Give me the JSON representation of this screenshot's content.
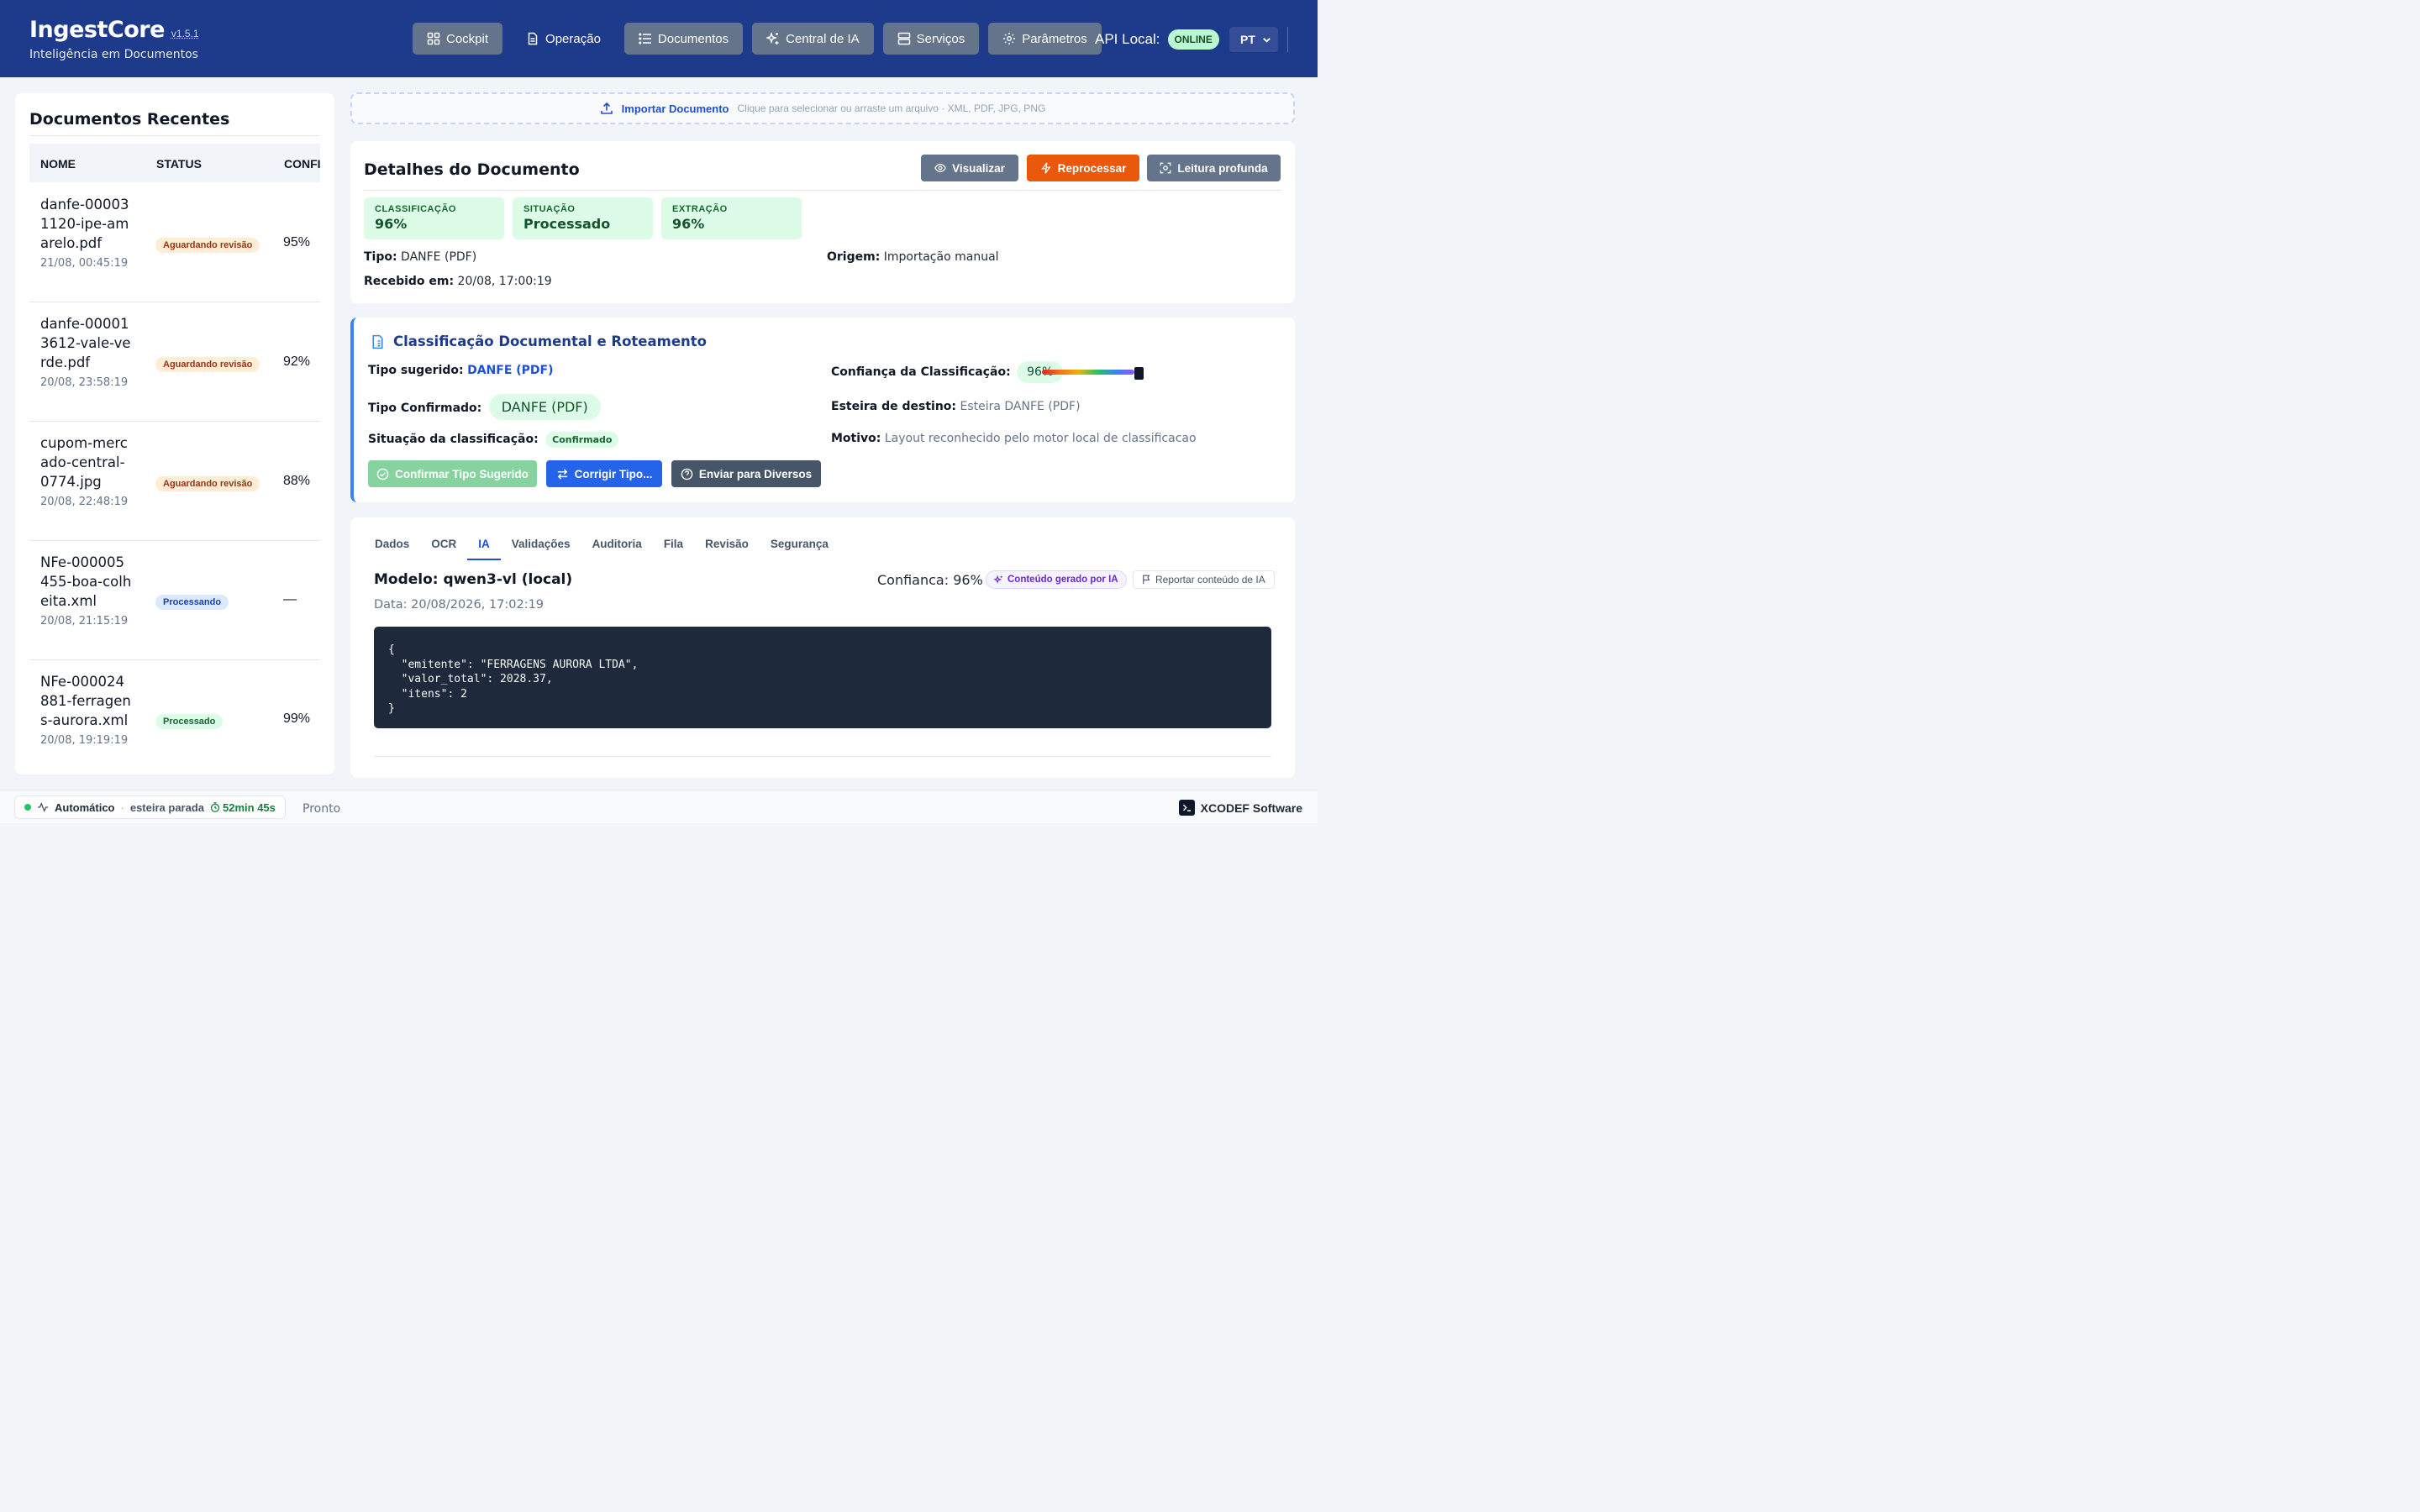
{
  "header": {
    "brand": "IngestCore",
    "version": "v1.5.1",
    "subtitle": "Inteligência em Documentos",
    "nav": [
      {
        "label": "Cockpit",
        "icon": "grid-icon"
      },
      {
        "label": "Operação",
        "icon": "file-icon"
      },
      {
        "label": "Documentos",
        "icon": "list-icon"
      },
      {
        "label": "Central de IA",
        "icon": "sparkles-icon"
      },
      {
        "label": "Serviços",
        "icon": "server-icon"
      },
      {
        "label": "Parâmetros",
        "icon": "gear-icon"
      }
    ],
    "api_label": "API Local:",
    "api_status": "ONLINE",
    "language": "PT"
  },
  "recent": {
    "title": "Documentos Recentes",
    "columns": [
      "NOME",
      "STATUS",
      "CONFI"
    ],
    "rows": [
      {
        "name": "danfe-000031120-ipe-amarelo.pdf",
        "date": "21/08, 00:45:19",
        "status": "Aguardando revisão",
        "conf": "95%"
      },
      {
        "name": "danfe-000013612-vale-verde.pdf",
        "date": "20/08, 23:58:19",
        "status": "Aguardando revisão",
        "conf": "92%"
      },
      {
        "name": "cupom-mercado-central-0774.jpg",
        "date": "20/08, 22:48:19",
        "status": "Aguardando revisão",
        "conf": "88%"
      },
      {
        "name": "NFe-000005455-boa-colheita.xml",
        "date": "20/08, 21:15:19",
        "status": "Processando",
        "conf": "—"
      },
      {
        "name": "NFe-000024881-ferragens-aurora.xml",
        "date": "20/08, 19:19:19",
        "status": "Processado",
        "conf": "99%"
      }
    ]
  },
  "upload": {
    "label": "Importar Documento",
    "hint": "Clique para selecionar ou arraste um arquivo · XML, PDF, JPG, PNG"
  },
  "details": {
    "title": "Detalhes do Documento",
    "actions": {
      "view": "Visualizar",
      "reprocess": "Reprocessar",
      "deep": "Leitura profunda"
    },
    "metrics": [
      {
        "label": "CLASSIFICAÇÃO",
        "value": "96%"
      },
      {
        "label": "SITUAÇÃO",
        "value": "Processado"
      },
      {
        "label": "EXTRAÇÃO",
        "value": "96%"
      }
    ],
    "tipo_label": "Tipo:",
    "tipo": "DANFE (PDF)",
    "origem_label": "Origem:",
    "origem": "Importação manual",
    "recebido_label": "Recebido em:",
    "recebido": "20/08, 17:00:19"
  },
  "classification": {
    "title": "Classificação Documental e Roteamento",
    "suggested_label": "Tipo sugerido:",
    "suggested": "DANFE (PDF)",
    "confirmed_label": "Tipo Confirmado:",
    "confirmed": "DANFE (PDF)",
    "situation_label": "Situação da classificação:",
    "situation": "Confirmado",
    "confidence_label": "Confiança da Classificação:",
    "confidence": "96%",
    "confidence_value": 0.96,
    "lane_label": "Esteira de destino:",
    "lane": "Esteira DANFE (PDF)",
    "reason_label": "Motivo:",
    "reason": "Layout reconhecido pelo motor local de classificacao",
    "buttons": {
      "confirm": "Confirmar Tipo Sugerido",
      "fix": "Corrigir Tipo...",
      "send": "Enviar para Diversos"
    }
  },
  "ia": {
    "tabs": [
      "Dados",
      "OCR",
      "IA",
      "Validações",
      "Auditoria",
      "Fila",
      "Revisão",
      "Segurança"
    ],
    "active_tab": "IA",
    "model": "Modelo: qwen3-vl (local)",
    "date": "Data: 20/08/2026, 17:02:19",
    "confidence": "Confianca: 96%",
    "generated_badge": "Conteúdo gerado por IA",
    "report": "Reportar conteúdo de IA",
    "code": "{\n  \"emitente\": \"FERRAGENS AURORA LTDA\",\n  \"valor_total\": 2028.37,\n  \"itens\": 2\n}"
  },
  "footer": {
    "mode": "Automático",
    "separator": "·",
    "lane_state": "esteira parada",
    "timer": "52min 45s",
    "state": "Pronto",
    "brand": "XCODEF Software"
  },
  "colors": {
    "header": "#1e3a8a",
    "accent": "#1d4ed8",
    "reprocess": "#ea580c",
    "success_bg": "#dcfce7"
  }
}
